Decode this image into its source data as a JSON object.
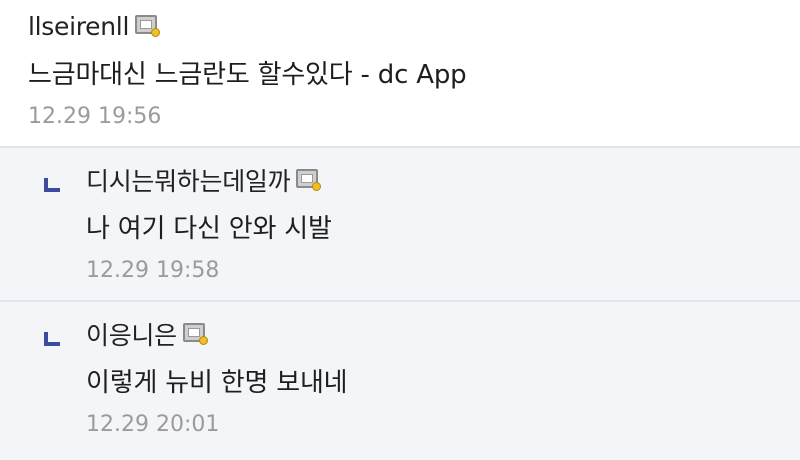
{
  "comments": [
    {
      "nickname": "llseirenll",
      "badge_icon": "gallery-user-badge-icon",
      "text": "느금마대신 느금란도 할수있다 - dc App",
      "time": "12.29 19:56"
    }
  ],
  "replies": [
    {
      "nickname": "디시는뭐하는데일까",
      "badge_icon": "gallery-user-badge-icon",
      "text": "나 여기 다신 안와 시발",
      "time": "12.29 19:58"
    },
    {
      "nickname": "이응니은",
      "badge_icon": "gallery-user-badge-icon",
      "text": "이렇게 뉴비 한명 보내네",
      "time": "12.29 20:01"
    }
  ],
  "colors": {
    "reply_background": "#f4f5f9",
    "reply_arrow": "#3c4aa0",
    "timestamp": "#9b9b9b",
    "divider": "#e2e4ec"
  }
}
